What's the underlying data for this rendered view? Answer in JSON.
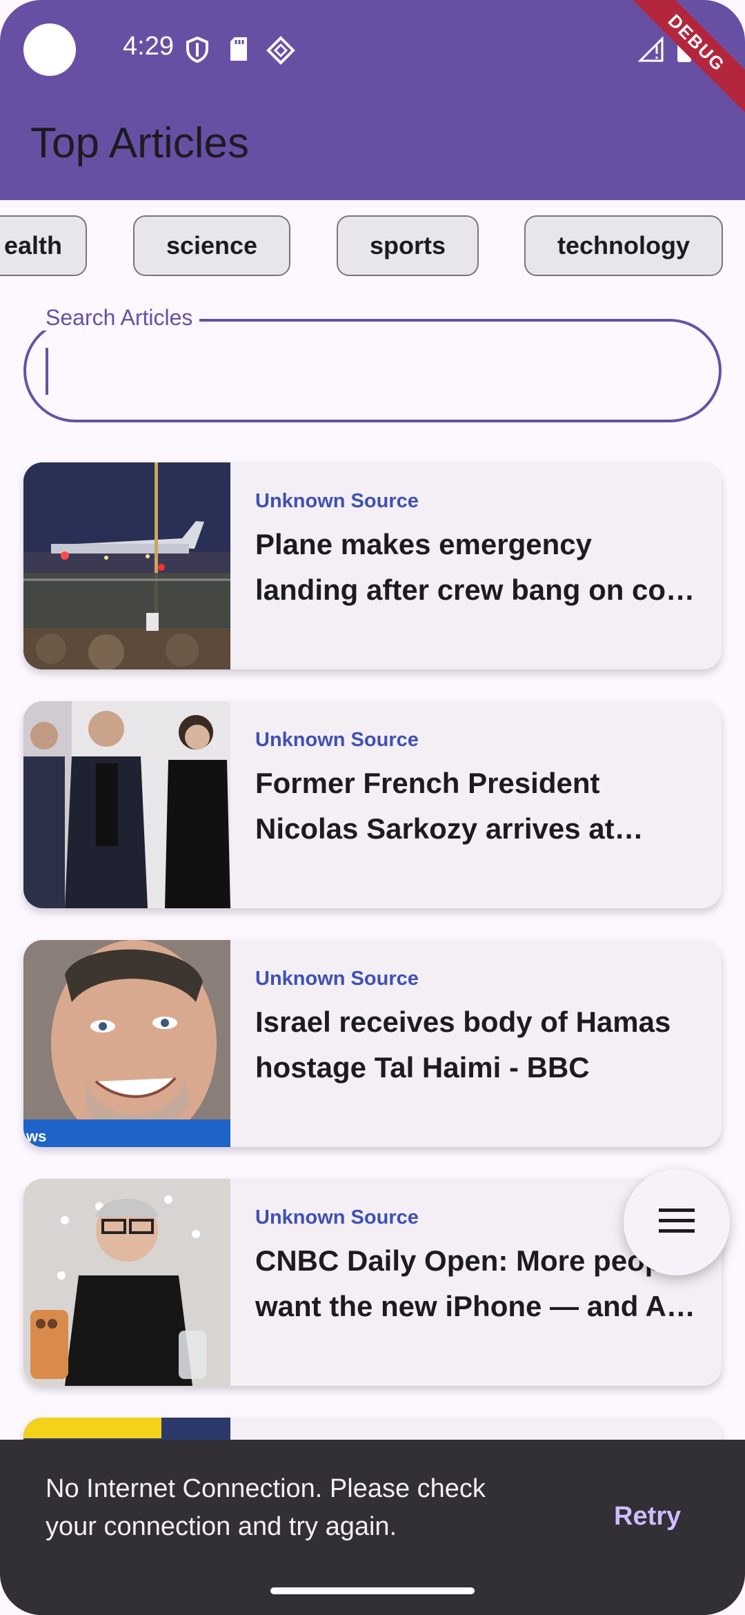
{
  "status_bar": {
    "time": "4:29",
    "debug_label": "DEBUG"
  },
  "app_bar": {
    "title": "Top Articles"
  },
  "categories": {
    "items": [
      {
        "label": "ealth"
      },
      {
        "label": "science"
      },
      {
        "label": "sports"
      },
      {
        "label": "technology"
      }
    ]
  },
  "search": {
    "label": "Search Articles",
    "value": "",
    "placeholder": ""
  },
  "articles": [
    {
      "source": "Unknown Source",
      "headline": "Plane makes emergency landing after crew bang on co…",
      "image": "plane-on-runway-night"
    },
    {
      "source": "Unknown Source",
      "headline": "Former French President Nicolas Sarkozy arrives at pris…",
      "image": "sarkozy-walking"
    },
    {
      "source": "Unknown Source",
      "headline": "Israel receives body of Hamas hostage Tal Haimi - BBC",
      "image": "smiling-man-portrait",
      "image_caption": "ws"
    },
    {
      "source": "Unknown Source",
      "headline": "CNBC Daily Open: More peop want the new iPhone — and A…",
      "image": "man-with-iphones"
    }
  ],
  "fab": {
    "icon": "menu-icon"
  },
  "snackbar": {
    "message": "No Internet Connection. Please check your connection and try again.",
    "action": "Retry"
  },
  "colors": {
    "primary": "#6750a4",
    "background": "#fdf7ff",
    "card": "#f3eff5",
    "source_text": "#3f51b5",
    "snackbar": "#322f35",
    "snackbar_action": "#d0bcff"
  }
}
